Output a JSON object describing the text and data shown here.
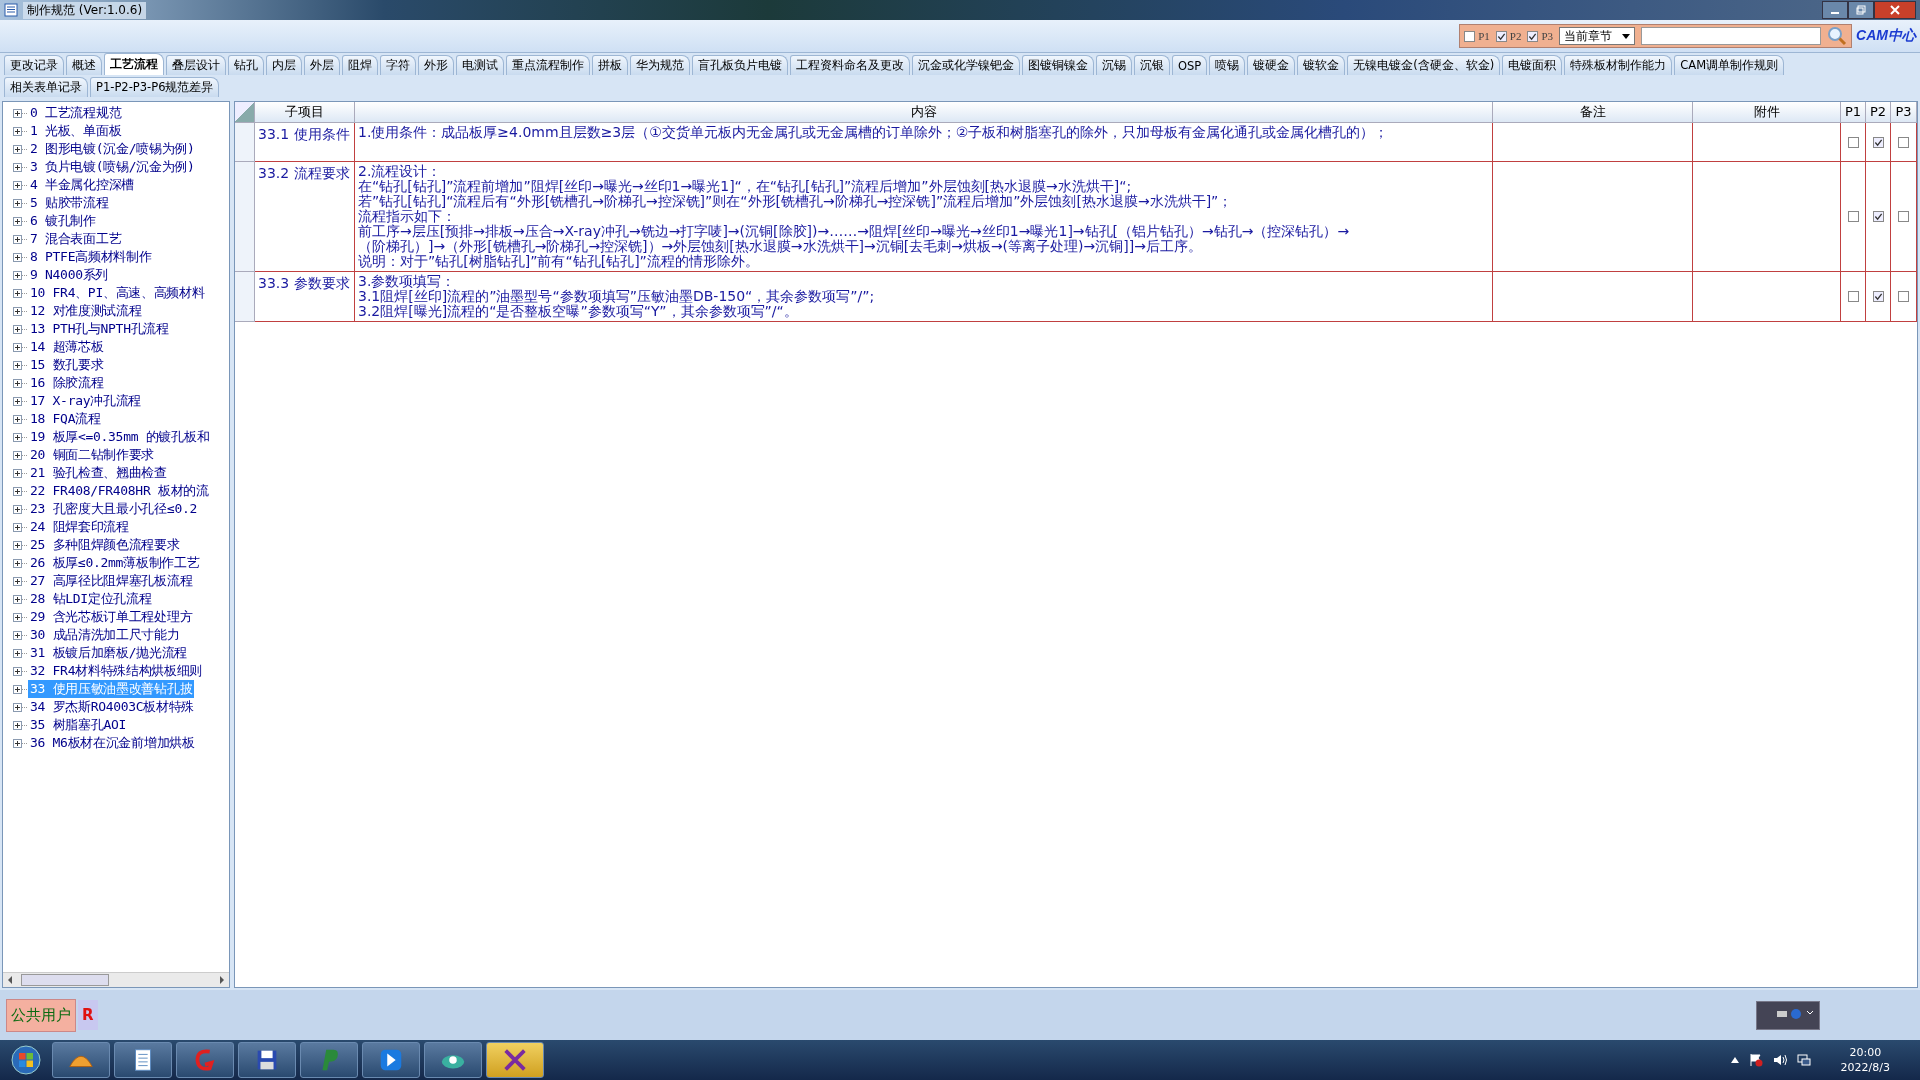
{
  "window": {
    "title": "制作规范 (Ver:1.0.6)"
  },
  "toolbar": {
    "filters": [
      {
        "label": "P1",
        "checked": false
      },
      {
        "label": "P2",
        "checked": true
      },
      {
        "label": "P3",
        "checked": true
      }
    ],
    "scope": {
      "value": "当前章节"
    },
    "logo": "CAM中心"
  },
  "tabs": [
    {
      "label": "更改记录",
      "selected": false
    },
    {
      "label": "概述",
      "selected": false
    },
    {
      "label": "工艺流程",
      "selected": true
    },
    {
      "label": "叠层设计",
      "selected": false
    },
    {
      "label": "钻孔",
      "selected": false
    },
    {
      "label": "内层",
      "selected": false
    },
    {
      "label": "外层",
      "selected": false
    },
    {
      "label": "阻焊",
      "selected": false
    },
    {
      "label": "字符",
      "selected": false
    },
    {
      "label": "外形",
      "selected": false
    },
    {
      "label": "电测试",
      "selected": false
    },
    {
      "label": "重点流程制作",
      "selected": false
    },
    {
      "label": "拼板",
      "selected": false
    },
    {
      "label": "华为规范",
      "selected": false
    },
    {
      "label": "盲孔板负片电镀",
      "selected": false
    },
    {
      "label": "工程资料命名及更改",
      "selected": false
    },
    {
      "label": "沉金或化学镍钯金",
      "selected": false
    },
    {
      "label": "图镀铜镍金",
      "selected": false
    },
    {
      "label": "沉锡",
      "selected": false
    },
    {
      "label": "沉银",
      "selected": false
    },
    {
      "label": "OSP",
      "selected": false
    },
    {
      "label": "喷锡",
      "selected": false
    },
    {
      "label": "镀硬金",
      "selected": false
    },
    {
      "label": "镀软金",
      "selected": false
    },
    {
      "label": "无镍电镀金(含硬金、软金)",
      "selected": false
    },
    {
      "label": "电镀面积",
      "selected": false
    },
    {
      "label": "特殊板材制作能力",
      "selected": false
    },
    {
      "label": "CAM调单制作规则",
      "selected": false
    }
  ],
  "subtabs": [
    {
      "label": "相关表单记录",
      "selected": false
    },
    {
      "label": "P1-P2-P3-P6规范差异",
      "selected": false
    }
  ],
  "tree": [
    {
      "label": "0 工艺流程规范",
      "selected": false,
      "expanded": false
    },
    {
      "label": "1 光板、单面板",
      "selected": false,
      "expanded": false
    },
    {
      "label": "2 图形电镀(沉金/喷锡为例)",
      "selected": false,
      "expanded": false
    },
    {
      "label": "3 负片电镀(喷锡/沉金为例)",
      "selected": false,
      "expanded": false
    },
    {
      "label": "4 半金属化控深槽",
      "selected": false,
      "expanded": false
    },
    {
      "label": "5 贴胶带流程",
      "selected": false,
      "expanded": false
    },
    {
      "label": "6 镀孔制作",
      "selected": false,
      "expanded": false
    },
    {
      "label": "7 混合表面工艺",
      "selected": false,
      "expanded": false
    },
    {
      "label": "8 PTFE高频材料制作",
      "selected": false,
      "expanded": false
    },
    {
      "label": "9 N4000系列",
      "selected": false,
      "expanded": false
    },
    {
      "label": "10 FR4、PI、高速、高频材料",
      "selected": false,
      "expanded": false
    },
    {
      "label": "12 对准度测试流程",
      "selected": false,
      "expanded": false
    },
    {
      "label": "13 PTH孔与NPTH孔流程",
      "selected": false,
      "expanded": false
    },
    {
      "label": "14 超薄芯板",
      "selected": false,
      "expanded": false
    },
    {
      "label": "15 数孔要求",
      "selected": false,
      "expanded": false
    },
    {
      "label": "16 除胶流程",
      "selected": false,
      "expanded": false
    },
    {
      "label": "17 X-ray冲孔流程",
      "selected": false,
      "expanded": false
    },
    {
      "label": "18 FQA流程",
      "selected": false,
      "expanded": false
    },
    {
      "label": "19 板厚<=0.35mm 的镀孔板和",
      "selected": false,
      "expanded": false
    },
    {
      "label": "20 铜面二钻制作要求",
      "selected": false,
      "expanded": false
    },
    {
      "label": "21 验孔检查、翘曲检查",
      "selected": false,
      "expanded": false
    },
    {
      "label": "22 FR408/FR408HR 板材的流",
      "selected": false,
      "expanded": false
    },
    {
      "label": "23 孔密度大且最小孔径≤0.2",
      "selected": false,
      "expanded": false
    },
    {
      "label": "24 阻焊套印流程",
      "selected": false,
      "expanded": false
    },
    {
      "label": "25 多种阻焊颜色流程要求",
      "selected": false,
      "expanded": false
    },
    {
      "label": "26 板厚≤0.2mm薄板制作工艺",
      "selected": false,
      "expanded": false
    },
    {
      "label": "27 高厚径比阻焊塞孔板流程",
      "selected": false,
      "expanded": false
    },
    {
      "label": "28 钻LDI定位孔流程",
      "selected": false,
      "expanded": false
    },
    {
      "label": "29 含光芯板订单工程处理方",
      "selected": false,
      "expanded": false
    },
    {
      "label": "30 成品清洗加工尺寸能力",
      "selected": false,
      "expanded": false
    },
    {
      "label": "31 板镀后加磨板/抛光流程",
      "selected": false,
      "expanded": false
    },
    {
      "label": "32 FR4材料特殊结构烘板细则",
      "selected": false,
      "expanded": false
    },
    {
      "label": "33 使用压敏油墨改善钻孔披",
      "selected": true,
      "expanded": false
    },
    {
      "label": "34 罗杰斯RO4003C板材特殊",
      "selected": false,
      "expanded": false
    },
    {
      "label": "35 树脂塞孔AOI",
      "selected": false,
      "expanded": false
    },
    {
      "label": "36 M6板材在沉金前增加烘板",
      "selected": false,
      "expanded": false
    }
  ],
  "table": {
    "columns": [
      "子项目",
      "内容",
      "备注",
      "附件",
      "P1",
      "P2",
      "P3"
    ],
    "rows": [
      {
        "item": "33.1 使用条件",
        "content": [
          "1.使用条件：成品板厚≥4.0mm且层数≥3层（①交货单元板内无金属孔或无金属槽的订单除外；②子板和树脂塞孔的除外，只加母板有金属化通孔或金属化槽孔的）；"
        ],
        "p1": false,
        "p2": true,
        "p3": false
      },
      {
        "item": "33.2 流程要求",
        "content": [
          "2.流程设计：",
          "在“钻孔[钻孔]”流程前增加”阻焊[丝印→曝光→丝印1→曝光1]“，在“钻孔[钻孔]”流程后增加”外层蚀刻[热水退膜→水洗烘干]“;",
          "若”钻孔[钻孔]“流程后有“外形[铣槽孔→阶梯孔→控深铣]”则在“外形[铣槽孔→阶梯孔→控深铣]”流程后增加”外层蚀刻[热水退膜→水洗烘干]”；",
          "流程指示如下：",
          "前工序→层压[预排→排板→压合→X-ray冲孔→铣边→打字唛]→(沉铜[除胶])→……→阻焊[丝印→曝光→丝印1→曝光1]→钻孔[（铝片钻孔）→钻孔→（控深钻孔）→",
          "（阶梯孔）]→（外形[铣槽孔→阶梯孔→控深铣]）→外层蚀刻[热水退膜→水洗烘干]→沉铜[去毛刺→烘板→(等离子处理)→沉铜]]→后工序。",
          "说明：对于”钻孔[树脂钻孔]”前有“钻孔[钻孔]”流程的情形除外。"
        ],
        "p1": false,
        "p2": true,
        "p3": false
      },
      {
        "item": "33.3 参数要求",
        "content": [
          "3.参数项填写：",
          "3.1阻焊[丝印]流程的”油墨型号“参数项填写”压敏油墨DB-150“，其余参数项写”/”;",
          "3.2阻焊[曝光]流程的“是否整板空曝”参数项写“Y”，其余参数项写”/“。"
        ],
        "p1": false,
        "p2": true,
        "p3": false
      }
    ]
  },
  "status_bar": {
    "user": "公共用户",
    "role": "R"
  },
  "taskbar": {
    "apps": [
      {
        "kind": "shell",
        "selected": false
      },
      {
        "kind": "notepad",
        "selected": false
      },
      {
        "kind": "swirl",
        "selected": false
      },
      {
        "kind": "floppy",
        "selected": false
      },
      {
        "kind": "p",
        "selected": false
      },
      {
        "kind": "arrow",
        "selected": false
      },
      {
        "kind": "eye",
        "selected": false
      },
      {
        "kind": "x",
        "selected": true
      }
    ],
    "time": "20:00",
    "date": "2022/8/3"
  }
}
